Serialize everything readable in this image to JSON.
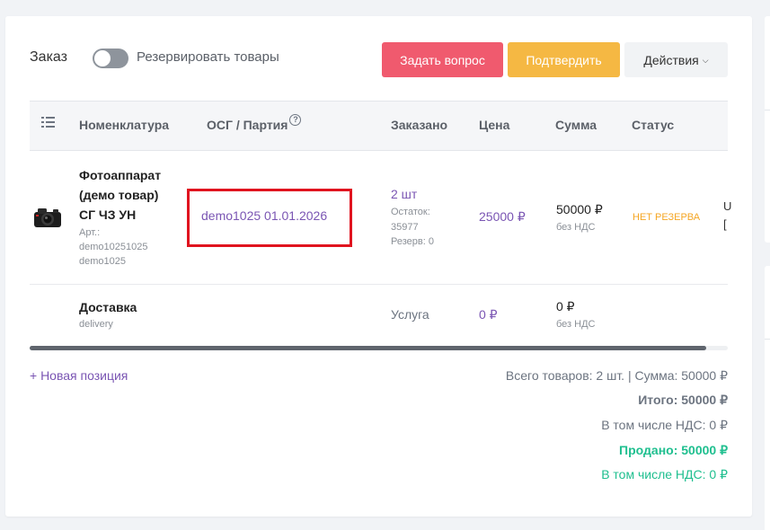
{
  "header": {
    "title": "Заказ",
    "toggle_label": "Резервировать товары",
    "toggle_on": false,
    "ask_label": "Задать вопрос",
    "confirm_label": "Подтвердить",
    "actions_label": "Действия"
  },
  "table": {
    "columns": [
      "Номенклатура",
      "ОСГ / Партия",
      "Заказано",
      "Цена",
      "Сумма",
      "Статус"
    ],
    "rows": [
      {
        "name": "Фотоаппарат (демо товар) СГ ЧЗ УН",
        "art_label": "Арт.:",
        "art_value": "demo10251025",
        "code": "demo1025",
        "batch": "demo1025 01.01.2026",
        "qty": "2 шт",
        "stock_label": "Остаток:",
        "stock_value": "35977",
        "reserve": "Резерв: 0",
        "price": "25000 ₽",
        "sum": "50000 ₽",
        "vat_note": "без НДС",
        "status": "НЕТ РЕЗЕРВА",
        "clipped_1": "U",
        "clipped_2": "["
      },
      {
        "name": "Доставка",
        "code": "delivery",
        "qty": "Услуга",
        "price": "0 ₽",
        "sum": "0 ₽",
        "vat_note": "без НДС"
      }
    ]
  },
  "footer": {
    "new_position": "+ Новая позиция",
    "summary": "Всего товаров: 2 шт. | Сумма: 50000 ₽",
    "total": "Итого: 50000 ₽",
    "vat": "В том числе НДС: 0 ₽",
    "sold": "Продано: 50000 ₽",
    "sold_vat": "В том числе НДС: 0 ₽"
  },
  "colors": {
    "accent_purple": "#7a55b3",
    "ask_button": "#f05a6e",
    "confirm_button": "#f5b843",
    "status_orange": "#f5a623",
    "sold_green": "#1fbf8f",
    "highlight_red": "#e0141f"
  },
  "icons": [
    "list-settings-icon",
    "question-circle-icon",
    "camera-icon",
    "chevron-down-icon"
  ]
}
